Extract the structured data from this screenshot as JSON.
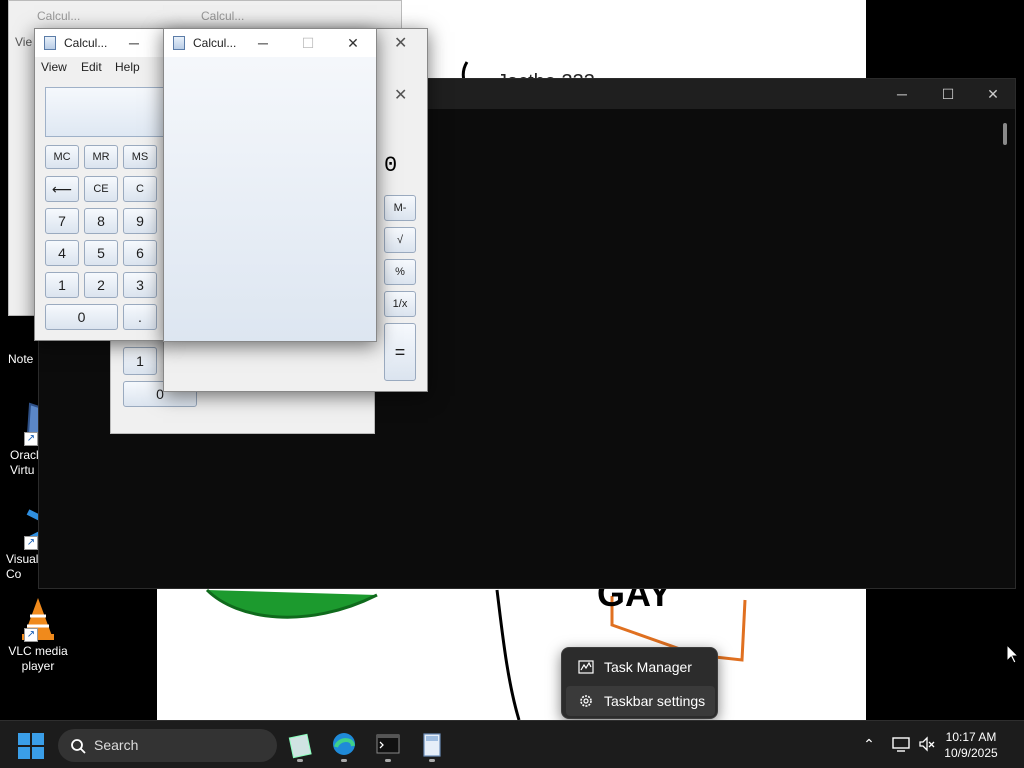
{
  "desktop": {
    "icons": [
      {
        "name": "notepad",
        "label": "Note"
      },
      {
        "name": "virtualbox",
        "label": "Oracl\nVirtu"
      },
      {
        "name": "vscode",
        "label": "Visual\nCo"
      },
      {
        "name": "vlc",
        "label": "VLC media\nplayer"
      }
    ],
    "wallpaper_text": "GAY",
    "wallpaper_top_text": "Jacthe 333"
  },
  "terminal": {
    "minimize": "─",
    "maximize": "☐",
    "close": "✕"
  },
  "calculator_front": {
    "title": "Calcul...",
    "menu": [
      "View",
      "Edit",
      "Help"
    ],
    "memory_keys": [
      "MC",
      "MR",
      "MS"
    ],
    "edit_keys": [
      "⟵",
      "CE",
      "C"
    ],
    "digits_row1": [
      "7",
      "8",
      "9"
    ],
    "digits_row2": [
      "4",
      "5",
      "6"
    ],
    "digits_row3": [
      "1",
      "2",
      "3"
    ],
    "zero": "0",
    "dot": ".",
    "minimize": "─",
    "close": "✕"
  },
  "calculator_blank": {
    "title": "Calcul...",
    "minimize": "─",
    "maximize": "☐",
    "close": "✕"
  },
  "calculator_back": {
    "title": "Calcul...",
    "display_value": "0",
    "side_keys": [
      "M-",
      "√",
      "%",
      "1/x",
      "="
    ],
    "close": "✕",
    "menu_view": "Vie",
    "bottom_one": "1",
    "bottom_zero": "0"
  },
  "context_menu": {
    "items": [
      {
        "label": "Task Manager",
        "icon": "task-manager-icon"
      },
      {
        "label": "Taskbar settings",
        "icon": "gear-icon"
      }
    ]
  },
  "taskbar": {
    "search_label": "Search",
    "apps": [
      "calculator-stack",
      "edge",
      "terminal",
      "calculator"
    ],
    "time": "10:17 AM",
    "date": "10/9/2025",
    "accent": "#3a9ee8"
  }
}
